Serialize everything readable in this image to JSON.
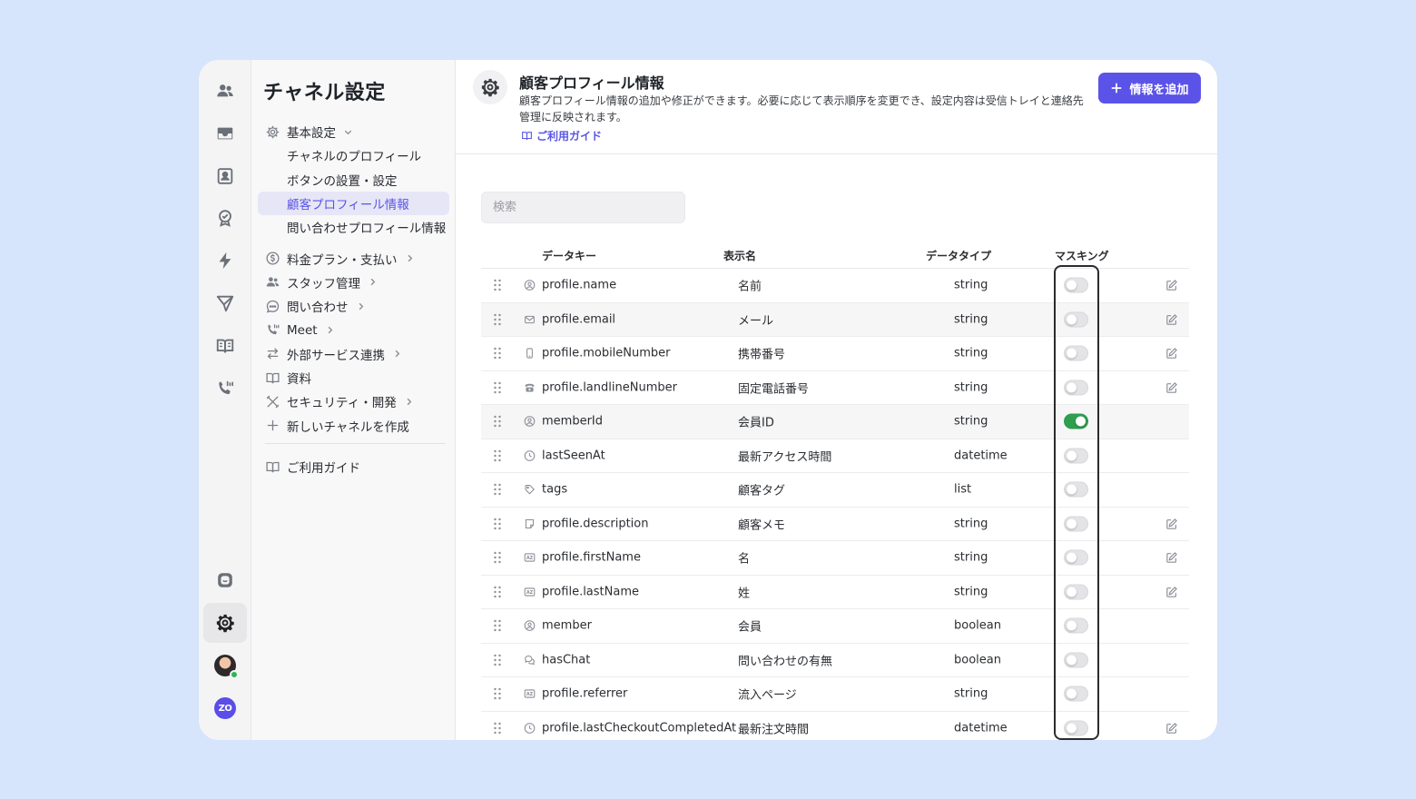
{
  "sidebar": {
    "title": "チャネル設定",
    "basic": {
      "label": "基本設定",
      "icon": "gear-icon"
    },
    "sub_items": [
      {
        "label": "チャネルのプロフィール"
      },
      {
        "label": "ボタンの設置・設定"
      },
      {
        "label": "顧客プロフィール情報",
        "active": true
      },
      {
        "label": "問い合わせプロフィール情報"
      }
    ],
    "items": [
      {
        "label": "料金プラン・支払い",
        "icon": "dollar-circle-icon"
      },
      {
        "label": "スタッフ管理",
        "icon": "users-icon"
      },
      {
        "label": "問い合わせ",
        "icon": "chat-bubble-icon"
      },
      {
        "label": "Meet",
        "icon": "phone-icon"
      },
      {
        "label": "外部サービス連携",
        "icon": "arrows-swap-icon"
      },
      {
        "label": "資料",
        "icon": "book-icon"
      },
      {
        "label": "セキュリティ・開発",
        "icon": "tools-icon"
      },
      {
        "label": "新しいチャネルを作成",
        "icon": "plus-icon"
      }
    ],
    "guide": {
      "label": "ご利用ガイド",
      "icon": "book-icon"
    }
  },
  "header": {
    "title": "顧客プロフィール情報",
    "description": "顧客プロフィール情報の追加や修正ができます。必要に応じて表示順序を変更でき、設定内容は受信トレイと連絡先管理に反映されます。",
    "guide_link": "ご利用ガイド",
    "add_button": "情報を追加"
  },
  "search": {
    "placeholder": "検索"
  },
  "table": {
    "columns": {
      "key": "データキー",
      "name": "表示名",
      "type": "データタイプ",
      "masking": "マスキング"
    },
    "rows": [
      {
        "icon": "user-circle-icon",
        "key": "profile.name",
        "name": "名前",
        "type": "string",
        "masking": false,
        "editable": true
      },
      {
        "icon": "mail-icon",
        "key": "profile.email",
        "name": "メール",
        "type": "string",
        "masking": false,
        "editable": true
      },
      {
        "icon": "mobile-icon",
        "key": "profile.mobileNumber",
        "name": "携帯番号",
        "type": "string",
        "masking": false,
        "editable": true
      },
      {
        "icon": "landline-phone-icon",
        "key": "profile.landlineNumber",
        "name": "固定電話番号",
        "type": "string",
        "masking": false,
        "editable": true
      },
      {
        "icon": "user-circle-icon",
        "key": "memberId",
        "name": "会員ID",
        "type": "string",
        "masking": true,
        "editable": false
      },
      {
        "icon": "clock-icon",
        "key": "lastSeenAt",
        "name": "最新アクセス時間",
        "type": "datetime",
        "masking": false,
        "editable": false
      },
      {
        "icon": "tag-icon",
        "key": "tags",
        "name": "顧客タグ",
        "type": "list",
        "masking": false,
        "editable": false
      },
      {
        "icon": "note-icon",
        "key": "profile.description",
        "name": "顧客メモ",
        "type": "string",
        "masking": false,
        "editable": true
      },
      {
        "icon": "az-icon",
        "key": "profile.firstName",
        "name": "名",
        "type": "string",
        "masking": false,
        "editable": true
      },
      {
        "icon": "az-icon",
        "key": "profile.lastName",
        "name": "姓",
        "type": "string",
        "masking": false,
        "editable": true
      },
      {
        "icon": "user-circle-icon",
        "key": "member",
        "name": "会員",
        "type": "boolean",
        "masking": false,
        "editable": false
      },
      {
        "icon": "chats-icon",
        "key": "hasChat",
        "name": "問い合わせの有無",
        "type": "boolean",
        "masking": false,
        "editable": false
      },
      {
        "icon": "az-icon",
        "key": "profile.referrer",
        "name": "流入ページ",
        "type": "string",
        "masking": false,
        "editable": false
      },
      {
        "icon": "clock-icon",
        "key": "profile.lastCheckoutCompletedAt",
        "name": "最新注文時間",
        "type": "datetime",
        "masking": false,
        "editable": true
      }
    ]
  },
  "colors": {
    "accent": "#5b53e8",
    "toggle_on": "#2f9e4f",
    "background": "#d6e4fc"
  }
}
